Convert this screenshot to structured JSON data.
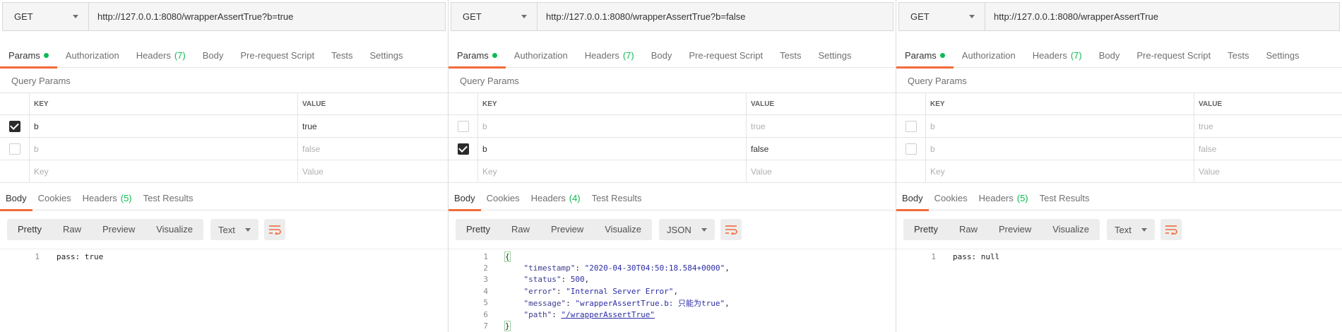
{
  "panels": [
    {
      "method": "GET",
      "url": "http://127.0.0.1:8080/wrapperAssertTrue?b=true",
      "req_tabs": [
        "Params",
        "Authorization",
        "Headers",
        "Body",
        "Pre-request Script",
        "Tests",
        "Settings"
      ],
      "req_headers_count": "(7)",
      "query_params_title": "Query Params",
      "col_key": "KEY",
      "col_value": "VALUE",
      "rows": [
        {
          "key": "b",
          "value": "true",
          "checked": true
        },
        {
          "key": "b",
          "value": "false",
          "checked": false
        }
      ],
      "key_placeholder": "Key",
      "value_placeholder": "Value",
      "resp_tabs": [
        "Body",
        "Cookies",
        "Headers",
        "Test Results"
      ],
      "resp_headers_count": "(5)",
      "view_modes": [
        "Pretty",
        "Raw",
        "Preview",
        "Visualize"
      ],
      "format": "Text",
      "code_lines": [
        "pass: true"
      ]
    },
    {
      "method": "GET",
      "url": "http://127.0.0.1:8080/wrapperAssertTrue?b=false",
      "req_tabs": [
        "Params",
        "Authorization",
        "Headers",
        "Body",
        "Pre-request Script",
        "Tests",
        "Settings"
      ],
      "req_headers_count": "(7)",
      "query_params_title": "Query Params",
      "col_key": "KEY",
      "col_value": "VALUE",
      "rows": [
        {
          "key": "b",
          "value": "true",
          "checked": false
        },
        {
          "key": "b",
          "value": "false",
          "checked": true
        }
      ],
      "key_placeholder": "Key",
      "value_placeholder": "Value",
      "resp_tabs": [
        "Body",
        "Cookies",
        "Headers",
        "Test Results"
      ],
      "resp_headers_count": "(4)",
      "view_modes": [
        "Pretty",
        "Raw",
        "Preview",
        "Visualize"
      ],
      "format": "JSON",
      "json_body": {
        "open": "{",
        "close": "}",
        "fields": [
          {
            "key": "\"timestamp\"",
            "value": "\"2020-04-30T04:50:18.584+0000\"",
            "kind": "s",
            "comma": true
          },
          {
            "key": "\"status\"",
            "value": "500",
            "kind": "n",
            "comma": true
          },
          {
            "key": "\"error\"",
            "value": "\"Internal Server Error\"",
            "kind": "s",
            "comma": true
          },
          {
            "key": "\"message\"",
            "value": "\"wrapperAssertTrue.b: 只能为true\"",
            "kind": "s",
            "comma": true
          },
          {
            "key": "\"path\"",
            "value": "\"/wrapperAssertTrue\"",
            "kind": "link",
            "comma": false
          }
        ]
      }
    },
    {
      "method": "GET",
      "url": "http://127.0.0.1:8080/wrapperAssertTrue",
      "req_tabs": [
        "Params",
        "Authorization",
        "Headers",
        "Body",
        "Pre-request Script",
        "Tests",
        "Settings"
      ],
      "req_headers_count": "(7)",
      "query_params_title": "Query Params",
      "col_key": "KEY",
      "col_value": "VALUE",
      "rows": [
        {
          "key": "b",
          "value": "true",
          "checked": false
        },
        {
          "key": "b",
          "value": "false",
          "checked": false
        }
      ],
      "key_placeholder": "Key",
      "value_placeholder": "Value",
      "resp_tabs": [
        "Body",
        "Cookies",
        "Headers",
        "Test Results"
      ],
      "resp_headers_count": "(5)",
      "view_modes": [
        "Pretty",
        "Raw",
        "Preview",
        "Visualize"
      ],
      "format": "Text",
      "code_lines": [
        "pass: null"
      ]
    }
  ],
  "colors": {
    "accent": "#f26b3a",
    "count_green": "#0cbb52",
    "code_string": "#2c2ca6"
  },
  "icons": {
    "method_dropdown": "chevron-down-icon",
    "wrap": "wrap-lines-icon",
    "params_dot": "status-dot-icon"
  }
}
